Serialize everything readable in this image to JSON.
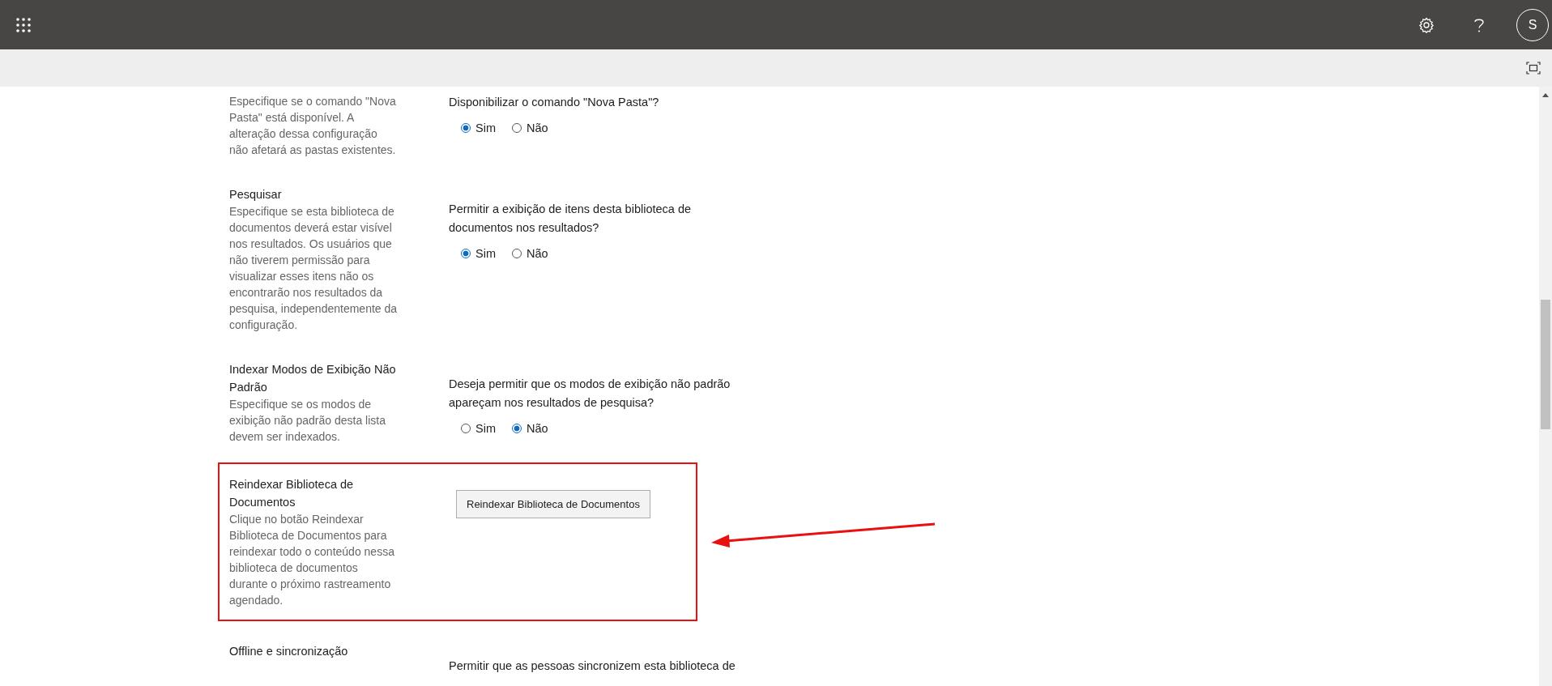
{
  "top_bar": {
    "avatar": "S"
  },
  "sections": [
    {
      "kind": "radio",
      "description": "Especifique se o comando \"Nova Pasta\" está disponível. A alteração dessa configuração não afetará as pastas existentes.",
      "question": "Disponibilizar o comando \"Nova Pasta\"?",
      "options": [
        {
          "label": "Sim",
          "selected": true
        },
        {
          "label": "Não",
          "selected": false
        }
      ],
      "highlighted": false
    },
    {
      "kind": "radio",
      "title": "Pesquisar",
      "description": "Especifique se esta biblioteca de documentos deverá estar visível nos resultados. Os usuários que não tiverem permissão para visualizar esses itens não os encontrarão nos resultados da pesquisa, independentemente da configuração.",
      "question": "Permitir a exibição de itens desta biblioteca de documentos nos resultados?",
      "options": [
        {
          "label": "Sim",
          "selected": true
        },
        {
          "label": "Não",
          "selected": false
        }
      ],
      "highlighted": false
    },
    {
      "kind": "radio",
      "title": "Indexar Modos de Exibição Não Padrão",
      "description": "Especifique se os modos de exibição não padrão desta lista devem ser indexados.",
      "question": "Deseja permitir que os modos de exibição não padrão apareçam nos resultados de pesquisa?",
      "options": [
        {
          "label": "Sim",
          "selected": false
        },
        {
          "label": "Não",
          "selected": true
        }
      ],
      "highlighted": false
    },
    {
      "kind": "button",
      "title": "Reindexar Biblioteca de Documentos",
      "description": "Clique no botão Reindexar Biblioteca de Documentos para reindexar todo o conteúdo nessa biblioteca de documentos durante o próximo rastreamento agendado.",
      "button": "Reindexar Biblioteca de Documentos",
      "highlighted": true
    },
    {
      "kind": "radio",
      "title": "Offline e sincronização",
      "question": "Permitir que as pessoas sincronizem esta biblioteca de",
      "highlighted": false
    }
  ]
}
